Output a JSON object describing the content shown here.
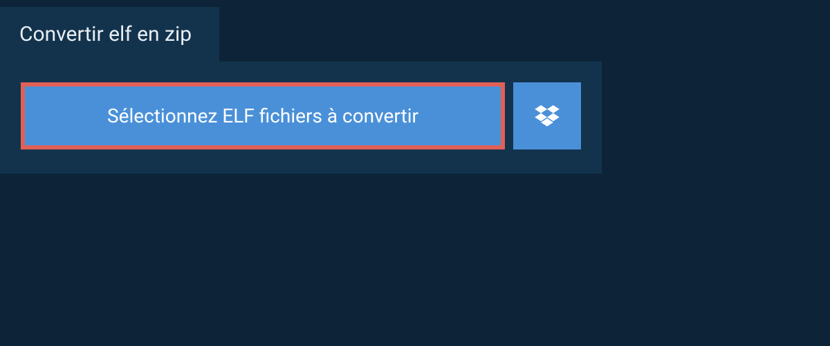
{
  "tab": {
    "title": "Convertir elf en zip"
  },
  "actions": {
    "select_label": "Sélectionnez ELF fichiers à convertir"
  },
  "colors": {
    "page_bg": "#0d2438",
    "panel_bg": "#13334d",
    "button_bg": "#4a90d9",
    "highlight_border": "#e06056",
    "text_light": "#e8eef3",
    "text_white": "#ffffff"
  }
}
